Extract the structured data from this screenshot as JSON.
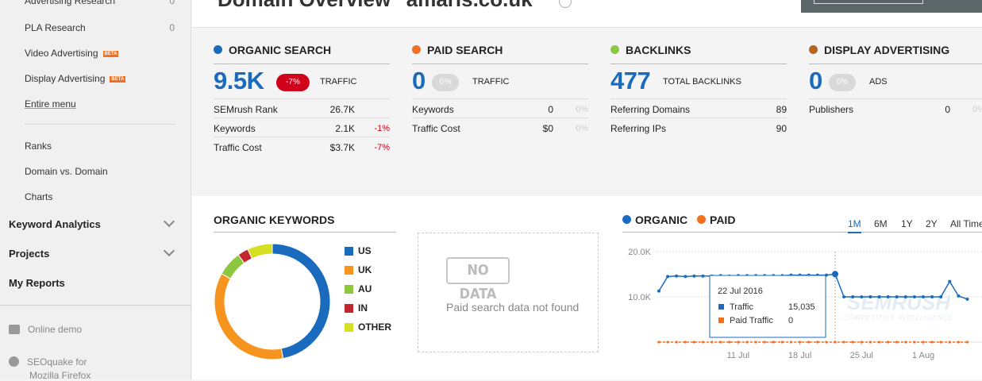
{
  "sidebar": {
    "items_top": [
      {
        "label": "Advertising Research",
        "count": "0"
      },
      {
        "label": "PLA Research",
        "count": "0"
      },
      {
        "label": "Video Advertising",
        "badge": "BETA"
      },
      {
        "label": "Display Advertising",
        "badge": "BETA"
      },
      {
        "label": "Entire menu"
      }
    ],
    "items_mid": [
      "Ranks",
      "Domain vs. Domain",
      "Charts"
    ],
    "sections": [
      "Keyword Analytics",
      "Projects",
      "My Reports"
    ],
    "bottom": [
      "Online demo",
      "SEOquake for",
      "Mozilla Firefox"
    ]
  },
  "header": {
    "title": "Domain Overview \"amaris.co.uk\""
  },
  "metrics": [
    {
      "title": "ORGANIC SEARCH",
      "color": "#1a6bbd",
      "big": "9.5K",
      "badge": "-7%",
      "badge_color": "#d0021b",
      "sub": "TRAFFIC",
      "rows": [
        {
          "label": "SEMrush Rank",
          "value": "26.7K",
          "pct": ""
        },
        {
          "label": "Keywords",
          "value": "2.1K",
          "pct": "-1%"
        },
        {
          "label": "Traffic Cost",
          "value": "$3.7K",
          "pct": "-7%"
        }
      ]
    },
    {
      "title": "PAID SEARCH",
      "color": "#f27121",
      "big": "0",
      "badge": "0%",
      "badge_color": "#d9d9d9",
      "sub": "TRAFFIC",
      "rows": [
        {
          "label": "Keywords",
          "value": "0",
          "pct": "0%"
        },
        {
          "label": "Traffic Cost",
          "value": "$0",
          "pct": "0%"
        }
      ]
    },
    {
      "title": "BACKLINKS",
      "color": "#8dc63f",
      "big": "477",
      "badge": "",
      "sub": "TOTAL BACKLINKS",
      "rows": [
        {
          "label": "Referring Domains",
          "value": "89",
          "pct": ""
        },
        {
          "label": "Referring IPs",
          "value": "90",
          "pct": ""
        }
      ]
    },
    {
      "title": "DISPLAY ADVERTISING",
      "color": "#b5651d",
      "big": "0",
      "badge": "0%",
      "badge_color": "#d9d9d9",
      "sub": "ADS",
      "rows": [
        {
          "label": "Publishers",
          "value": "0",
          "pct": "0%"
        }
      ]
    }
  ],
  "organic_keywords": {
    "title": "ORGANIC KEYWORDS",
    "legend": [
      {
        "label": "US",
        "color": "#1a6bbd"
      },
      {
        "label": "UK",
        "color": "#f7941d"
      },
      {
        "label": "AU",
        "color": "#8dc63f"
      },
      {
        "label": "IN",
        "color": "#c1272d"
      },
      {
        "label": "OTHER",
        "color": "#d7df23"
      }
    ]
  },
  "paid_box": {
    "badge": "NO DATA",
    "message": "Paid search data not found"
  },
  "trend": {
    "legend": [
      {
        "label": "ORGANIC",
        "color": "#1a6bbd"
      },
      {
        "label": "PAID",
        "color": "#f27121"
      }
    ],
    "ranges": [
      "1M",
      "6M",
      "1Y",
      "2Y",
      "All Time"
    ],
    "active_range": "1M",
    "watermark": "SEMRUSH",
    "watermark_sub": "COMPETITIVE INTELLIGENCE"
  },
  "tooltip": {
    "date": "22 Jul 2016",
    "rows": [
      {
        "label": "Traffic",
        "value": "15,035",
        "color": "#1a6bbd"
      },
      {
        "label": "Paid Traffic",
        "value": "0",
        "color": "#f27121"
      }
    ]
  },
  "chart_data": [
    {
      "type": "pie",
      "title": "ORGANIC KEYWORDS",
      "categories": [
        "US",
        "UK",
        "AU",
        "IN",
        "OTHER"
      ],
      "values": [
        47,
        36,
        7,
        3,
        7
      ]
    },
    {
      "type": "line",
      "title": "",
      "xlabel": "",
      "ylabel": "",
      "x_ticks": [
        "11 Jul",
        "18 Jul",
        "25 Jul",
        "1 Aug"
      ],
      "y_ticks": [
        "10.0K",
        "20.0K"
      ],
      "ylim": [
        0,
        20000
      ],
      "x": [
        "2 Jul",
        "3 Jul",
        "4 Jul",
        "5 Jul",
        "6 Jul",
        "7 Jul",
        "8 Jul",
        "9 Jul",
        "10 Jul",
        "11 Jul",
        "12 Jul",
        "13 Jul",
        "14 Jul",
        "15 Jul",
        "16 Jul",
        "17 Jul",
        "18 Jul",
        "19 Jul",
        "20 Jul",
        "21 Jul",
        "22 Jul",
        "23 Jul",
        "24 Jul",
        "25 Jul",
        "26 Jul",
        "27 Jul",
        "28 Jul",
        "29 Jul",
        "30 Jul",
        "31 Jul",
        "1 Aug",
        "2 Aug",
        "3 Aug",
        "4 Aug",
        "5 Aug",
        "6 Aug"
      ],
      "series": [
        {
          "name": "ORGANIC",
          "values": [
            11300,
            14500,
            14600,
            14500,
            14600,
            14600,
            14600,
            14700,
            14600,
            14700,
            14700,
            14700,
            14700,
            14700,
            14700,
            14800,
            14800,
            14800,
            14800,
            14800,
            15035,
            10000,
            10000,
            10000,
            10000,
            10000,
            10000,
            10000,
            10000,
            10000,
            10000,
            10000,
            10000,
            13400,
            10200,
            9500
          ]
        },
        {
          "name": "PAID",
          "values": [
            0,
            0,
            0,
            0,
            0,
            0,
            0,
            0,
            0,
            0,
            0,
            0,
            0,
            0,
            0,
            0,
            0,
            0,
            0,
            0,
            0,
            0,
            0,
            0,
            0,
            0,
            0,
            0,
            0,
            0,
            0,
            0,
            0,
            0,
            0,
            0
          ]
        }
      ]
    }
  ]
}
